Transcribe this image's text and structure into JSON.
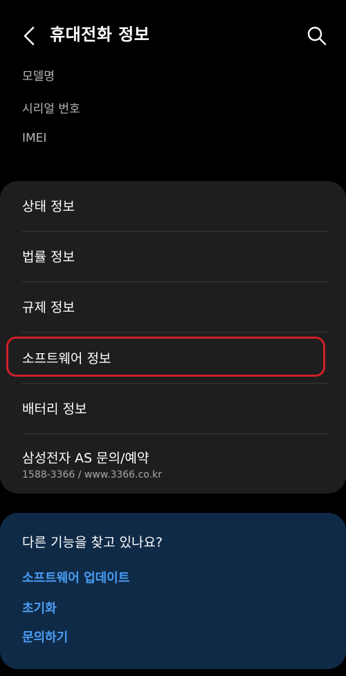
{
  "header": {
    "title": "휴대전화 정보",
    "back_icon": "chevron-left-icon",
    "search_icon": "search-icon"
  },
  "device_info": [
    {
      "label": "모델명"
    },
    {
      "label": "시리얼 번호"
    },
    {
      "label": "IMEI"
    }
  ],
  "menu": {
    "items": [
      {
        "label": "상태 정보"
      },
      {
        "label": "법률 정보"
      },
      {
        "label": "규제 정보"
      },
      {
        "label": "소프트웨어 정보"
      },
      {
        "label": "배터리 정보"
      },
      {
        "label": "삼성전자 AS 문의/예약",
        "sub": "1588-3366 / www.3366.co.kr"
      }
    ],
    "highlight_color": "#d0202a"
  },
  "suggest": {
    "title": "다른 기능을 찾고 있나요?",
    "links": [
      {
        "label": "소프트웨어 업데이트"
      },
      {
        "label": "초기화"
      },
      {
        "label": "문의하기"
      }
    ],
    "link_color": "#4a9df5",
    "background": "#0f2a47"
  }
}
